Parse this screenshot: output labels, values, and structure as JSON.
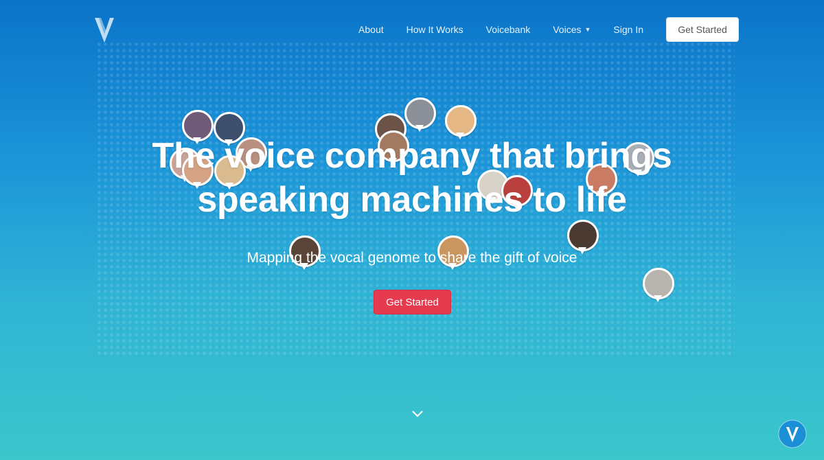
{
  "nav": {
    "links": [
      "About",
      "How It Works",
      "Voicebank",
      "Voices",
      "Sign In"
    ],
    "cta": "Get Started"
  },
  "hero": {
    "title_line1": "The voice company that brings",
    "title_line2": "speaking machines to life",
    "subtitle": "Mapping the vocal genome to share the gift of voice",
    "cta": "Get Started"
  },
  "icons": {
    "logo": "v-logo-icon",
    "dropdown": "caret-down-icon",
    "scroll": "chevron-down-icon",
    "chat": "chat-bubble-icon"
  },
  "colors": {
    "gradient_top": "#0b74c9",
    "gradient_bottom": "#3bc7cb",
    "cta_red": "#e63a4f"
  }
}
